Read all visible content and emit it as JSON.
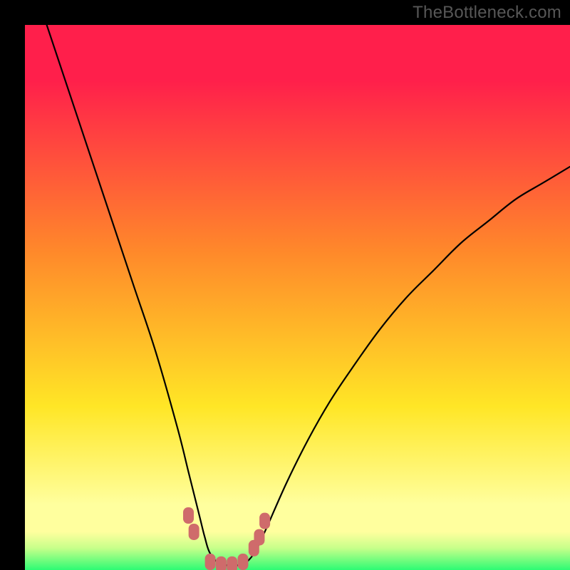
{
  "watermark": "TheBottleneck.com",
  "colors": {
    "bg": "#000000",
    "gradient_top": "#ff1f4b",
    "gradient_mid_orange": "#ff8a2a",
    "gradient_mid_yellow": "#ffe626",
    "gradient_light_yellow": "#ffff9e",
    "gradient_green": "#2dfb74",
    "curve": "#000000",
    "markers": "#cf6b6b"
  },
  "chart_data": {
    "type": "line",
    "title": "",
    "xlabel": "",
    "ylabel": "",
    "xlim": [
      0,
      100
    ],
    "ylim": [
      0,
      100
    ],
    "grid": false,
    "legend": false,
    "series": [
      {
        "name": "bottleneck-curve",
        "x": [
          4,
          8,
          12,
          16,
          20,
          24,
          28,
          30,
          32,
          33,
          34,
          36,
          38,
          40,
          42,
          44,
          48,
          52,
          56,
          60,
          65,
          70,
          75,
          80,
          85,
          90,
          95,
          100
        ],
        "values": [
          100,
          88,
          76,
          64,
          52,
          40,
          26,
          18,
          10,
          6,
          3,
          1,
          1,
          1,
          3,
          7,
          16,
          24,
          31,
          37,
          44,
          50,
          55,
          60,
          64,
          68,
          71,
          74
        ]
      }
    ],
    "markers": [
      {
        "x": 30,
        "y": 10
      },
      {
        "x": 31,
        "y": 7
      },
      {
        "x": 34,
        "y": 1.5
      },
      {
        "x": 36,
        "y": 1
      },
      {
        "x": 38,
        "y": 1
      },
      {
        "x": 40,
        "y": 1.5
      },
      {
        "x": 42,
        "y": 4
      },
      {
        "x": 43,
        "y": 6
      },
      {
        "x": 44,
        "y": 9
      }
    ],
    "gradient_bands": [
      {
        "y_from": 100,
        "y_to": 92,
        "zone": "red"
      },
      {
        "y_from": 92,
        "y_to": 55,
        "zone": "red-to-orange"
      },
      {
        "y_from": 55,
        "y_to": 25,
        "zone": "orange-to-yellow"
      },
      {
        "y_from": 25,
        "y_to": 10,
        "zone": "yellow"
      },
      {
        "y_from": 10,
        "y_to": 5,
        "zone": "light-yellow"
      },
      {
        "y_from": 5,
        "y_to": 0,
        "zone": "green"
      }
    ]
  }
}
